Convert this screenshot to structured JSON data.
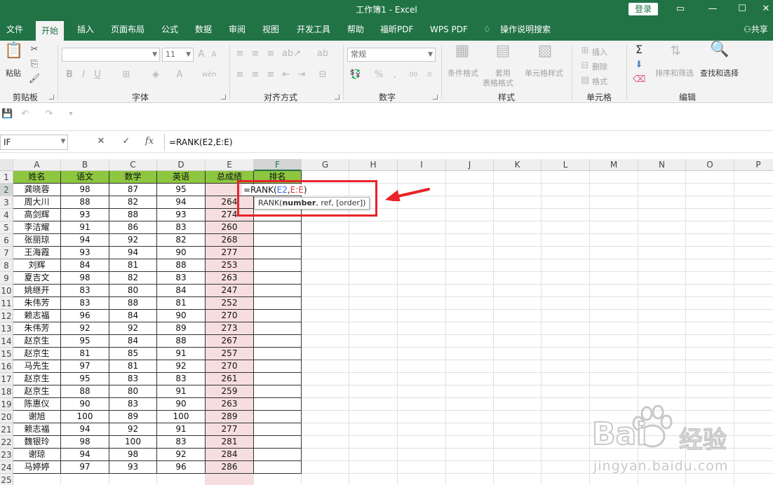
{
  "window": {
    "title": "工作簿1  -  Excel",
    "login_label": "登录",
    "share_label": "共享"
  },
  "tabs": [
    "文件",
    "开始",
    "插入",
    "页面布局",
    "公式",
    "数据",
    "审阅",
    "视图",
    "开发工具",
    "帮助",
    "福昕PDF",
    "WPS PDF"
  ],
  "active_tab": "开始",
  "search_label": "操作说明搜索",
  "ribbon": {
    "clipboard": {
      "group_label": "剪贴板",
      "paste_label": "粘贴"
    },
    "font": {
      "group_label": "字体",
      "size_value": "11",
      "font_value": ""
    },
    "alignment": {
      "group_label": "对齐方式"
    },
    "number": {
      "group_label": "数字",
      "format_value": "常规"
    },
    "styles": {
      "group_label": "样式",
      "cond_format_label": "条件格式",
      "table_format_label1": "套用",
      "table_format_label2": "表格格式",
      "cell_style_label": "单元格样式"
    },
    "cells": {
      "group_label": "单元格",
      "insert_label": "插入",
      "delete_label": "删除",
      "format_label": "格式"
    },
    "editing": {
      "group_label": "编辑",
      "sort_label": "排序和筛选",
      "find_label": "查找和选择"
    }
  },
  "formula_bar": {
    "name_box": "IF",
    "formula": "=RANK(E2,E:E)"
  },
  "grid": {
    "columns": [
      "A",
      "B",
      "C",
      "D",
      "E",
      "F",
      "G",
      "H",
      "I",
      "J",
      "K",
      "L",
      "M",
      "N",
      "O",
      "P"
    ],
    "active_column": "F",
    "active_row": "2",
    "header_row": [
      "姓名",
      "语文",
      "数学",
      "英语",
      "总成绩",
      "排名"
    ],
    "rows": [
      {
        "n": "2",
        "cells": [
          "龚晓蓉",
          "98",
          "87",
          "95",
          "",
          ""
        ]
      },
      {
        "n": "3",
        "cells": [
          "周大川",
          "88",
          "82",
          "94",
          "264",
          ""
        ]
      },
      {
        "n": "4",
        "cells": [
          "高剑辉",
          "93",
          "88",
          "93",
          "274",
          ""
        ]
      },
      {
        "n": "5",
        "cells": [
          "李洁耀",
          "91",
          "86",
          "83",
          "260",
          ""
        ]
      },
      {
        "n": "6",
        "cells": [
          "张丽琼",
          "94",
          "92",
          "82",
          "268",
          ""
        ]
      },
      {
        "n": "7",
        "cells": [
          "王海霞",
          "93",
          "94",
          "90",
          "277",
          ""
        ]
      },
      {
        "n": "8",
        "cells": [
          "刘辉",
          "84",
          "81",
          "88",
          "253",
          ""
        ]
      },
      {
        "n": "9",
        "cells": [
          "夏吉文",
          "98",
          "82",
          "83",
          "263",
          ""
        ]
      },
      {
        "n": "10",
        "cells": [
          "姚继开",
          "83",
          "80",
          "84",
          "247",
          ""
        ]
      },
      {
        "n": "11",
        "cells": [
          "朱伟芳",
          "83",
          "88",
          "81",
          "252",
          ""
        ]
      },
      {
        "n": "12",
        "cells": [
          "赖志福",
          "96",
          "84",
          "90",
          "270",
          ""
        ]
      },
      {
        "n": "13",
        "cells": [
          "朱伟芳",
          "92",
          "92",
          "89",
          "273",
          ""
        ]
      },
      {
        "n": "14",
        "cells": [
          "赵京生",
          "95",
          "84",
          "88",
          "267",
          ""
        ]
      },
      {
        "n": "15",
        "cells": [
          "赵京生",
          "81",
          "85",
          "91",
          "257",
          ""
        ]
      },
      {
        "n": "16",
        "cells": [
          "马先生",
          "97",
          "81",
          "92",
          "270",
          ""
        ]
      },
      {
        "n": "17",
        "cells": [
          "赵京生",
          "95",
          "83",
          "83",
          "261",
          ""
        ]
      },
      {
        "n": "18",
        "cells": [
          "赵京生",
          "88",
          "80",
          "91",
          "259",
          ""
        ]
      },
      {
        "n": "19",
        "cells": [
          "陈惠仪",
          "90",
          "83",
          "90",
          "263",
          ""
        ]
      },
      {
        "n": "20",
        "cells": [
          "谢旭",
          "100",
          "89",
          "100",
          "289",
          ""
        ]
      },
      {
        "n": "21",
        "cells": [
          "赖志福",
          "94",
          "92",
          "91",
          "277",
          ""
        ]
      },
      {
        "n": "22",
        "cells": [
          "魏银玲",
          "98",
          "100",
          "83",
          "281",
          ""
        ]
      },
      {
        "n": "23",
        "cells": [
          "谢琼",
          "94",
          "98",
          "92",
          "284",
          ""
        ]
      },
      {
        "n": "24",
        "cells": [
          "马婷婷",
          "97",
          "93",
          "96",
          "286",
          ""
        ]
      }
    ],
    "empty_row": "25"
  },
  "edit_cell": {
    "prefix": "=RANK(",
    "ref1": "E2",
    "comma": ",",
    "ref2": "E:E",
    "suffix": ")"
  },
  "tooltip": {
    "fn": "RANK(",
    "arg1": "number",
    "rest": ", ref, [order])"
  },
  "watermark": {
    "brand": "Bai",
    "brand2": "经验",
    "url": "jingyan.baidu.com"
  },
  "colors": {
    "excel_green": "#217346",
    "header_fill": "#8dc63f",
    "total_fill": "#f7dede",
    "highlight": "#e8242a"
  }
}
